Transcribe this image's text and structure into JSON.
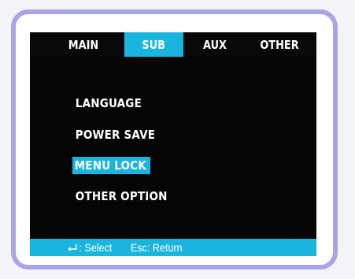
{
  "tabs": [
    {
      "label": "MAIN",
      "active": false
    },
    {
      "label": "SUB",
      "active": true
    },
    {
      "label": "AUX",
      "active": false
    },
    {
      "label": "OTHER",
      "active": false
    }
  ],
  "menu": {
    "items": [
      {
        "label": "LANGUAGE",
        "selected": false
      },
      {
        "label": "POWER SAVE",
        "selected": false
      },
      {
        "label": "MENU LOCK",
        "selected": true
      },
      {
        "label": "OTHER OPTION",
        "selected": false
      }
    ]
  },
  "statusbar": {
    "enter_icon": "enter-key-icon",
    "select_label": ": Select",
    "return_label": "Esc: Return"
  },
  "colors": {
    "accent": "#1ab5de",
    "screen_background": "#050505",
    "bezel_border": "#aaa3e6",
    "text": "#ffffff"
  }
}
